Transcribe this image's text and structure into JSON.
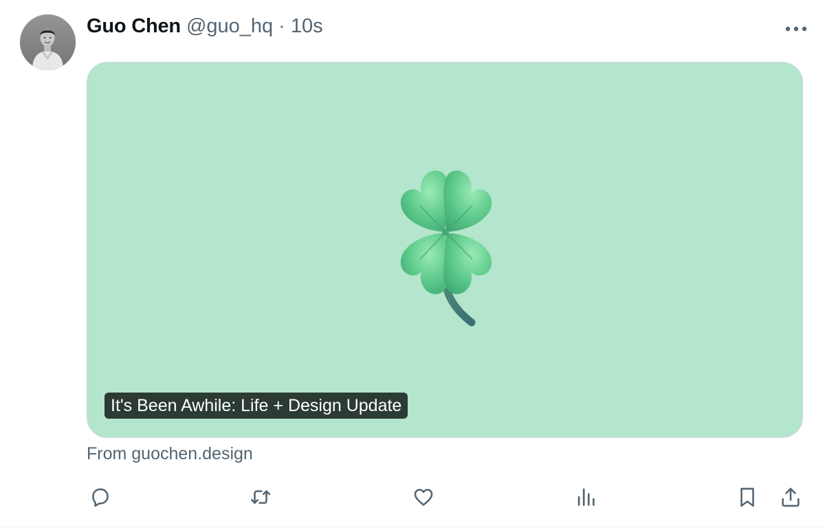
{
  "author": {
    "display_name": "Guo Chen",
    "handle": "@guo_hq",
    "separator": "·",
    "time": "10s"
  },
  "card": {
    "title": "It's Been Awhile: Life + Design Update",
    "image_icon": "four-leaf-clover-icon",
    "background_color": "#b4e5cd"
  },
  "source": {
    "text": "From guochen.design"
  },
  "actions": [
    {
      "name": "reply",
      "icon": "speech-bubble-icon"
    },
    {
      "name": "repost",
      "icon": "repost-arrows-icon"
    },
    {
      "name": "like",
      "icon": "heart-icon"
    },
    {
      "name": "views",
      "icon": "bar-chart-icon"
    },
    {
      "name": "bookmark",
      "icon": "bookmark-icon"
    },
    {
      "name": "share",
      "icon": "share-upload-icon"
    }
  ],
  "colors": {
    "text_primary": "#0f1419",
    "text_secondary": "#536471",
    "card_background": "#b4e5cd",
    "clover_green": "#5cc98a"
  }
}
